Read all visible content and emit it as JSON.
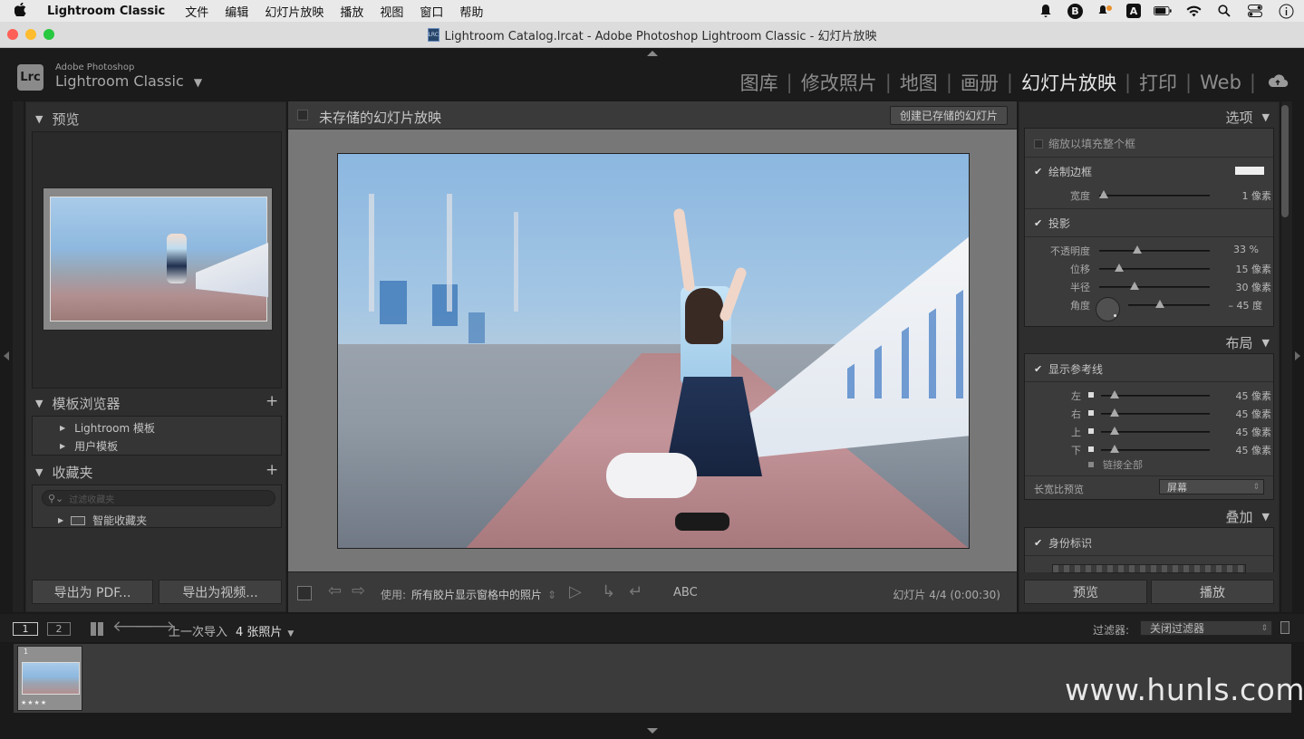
{
  "menubar": {
    "apple": "",
    "app": "Lightroom Classic",
    "items": [
      "文件",
      "编辑",
      "幻灯片放映",
      "播放",
      "视图",
      "窗口",
      "帮助"
    ],
    "status_icons": [
      "bell-icon",
      "b-badge-icon",
      "notification-icon",
      "a-input-icon",
      "battery-icon",
      "wifi-icon",
      "search-icon",
      "control-center-icon",
      "info-icon"
    ]
  },
  "window": {
    "title": "Lightroom Catalog.lrcat - Adobe Photoshop Lightroom Classic - 幻灯片放映",
    "doc_icon_text": "LRC"
  },
  "identity": {
    "badge": "Lrc",
    "adobe": "Adobe Photoshop",
    "product": "Lightroom Classic",
    "dropdown": "▼"
  },
  "modules": [
    {
      "label": "图库",
      "active": false
    },
    {
      "label": "修改照片",
      "active": false
    },
    {
      "label": "地图",
      "active": false
    },
    {
      "label": "画册",
      "active": false
    },
    {
      "label": "幻灯片放映",
      "active": true
    },
    {
      "label": "打印",
      "active": false
    },
    {
      "label": "Web",
      "active": false
    }
  ],
  "separator": "|",
  "left_panel": {
    "preview_title": "预览",
    "template_browser_title": "模板浏览器",
    "template_items": [
      "Lightroom 模板",
      "用户模板"
    ],
    "collections_title": "收藏夹",
    "collections_search_placeholder": "过滤收藏夹",
    "collections_items": [
      "智能收藏夹"
    ],
    "plus": "+",
    "export_pdf": "导出为 PDF...",
    "export_video": "导出为视频..."
  },
  "center": {
    "slideshow_title": "未存储的幻灯片放映",
    "create_saved": "创建已存储的幻灯片",
    "toolbar": {
      "use_label": "使用:",
      "use_value": "所有胶片显示窗格中的照片",
      "abc": "ABC",
      "slide_counter": "幻灯片 4/4 (0:00:30)"
    }
  },
  "right_panel": {
    "options_title": "选项",
    "zoom_fill": "缩放以填充整个框",
    "zoom_fill_checked": false,
    "stroke_border": "绘制边框",
    "stroke_border_checked": true,
    "stroke_width_label": "宽度",
    "stroke_width_value": "1 像素",
    "stroke_width_fraction": 0.0,
    "shadow": "投影",
    "shadow_checked": true,
    "shadow_rows": [
      {
        "label": "不透明度",
        "value": "33 %",
        "fraction": 0.33
      },
      {
        "label": "位移",
        "value": "15 像素",
        "fraction": 0.15
      },
      {
        "label": "半径",
        "value": "30 像素",
        "fraction": 0.3
      }
    ],
    "angle_label": "角度",
    "angle_value": "– 45 度",
    "angle_fraction": 0.375,
    "layout_title": "布局",
    "show_guides": "显示参考线",
    "show_guides_checked": true,
    "guide_rows": [
      {
        "label": "左",
        "value": "45 像素",
        "fraction": 0.09
      },
      {
        "label": "右",
        "value": "45 像素",
        "fraction": 0.09
      },
      {
        "label": "上",
        "value": "45 像素",
        "fraction": 0.09
      },
      {
        "label": "下",
        "value": "45 像素",
        "fraction": 0.09
      }
    ],
    "link_all": "链接全部",
    "aspect_label": "长宽比预览",
    "aspect_value": "屏幕",
    "overlays_title": "叠加",
    "identity_plate": "身份标识",
    "identity_plate_checked": true,
    "preview_button": "预览",
    "play_button": "播放"
  },
  "filmbar": {
    "view1": "1",
    "view2": "2",
    "source": "上一次导入",
    "count": "4 张照片",
    "filter_label": "过滤器:",
    "filter_value": "关闭过滤器"
  },
  "filmstrip": {
    "thumb_index": "1",
    "thumb_stars": "★★★★"
  },
  "watermark": "www.hunls.com",
  "colors": {
    "sky": "#8db6dd",
    "accent_active": "#e6e6e6",
    "panel_bg": "#2e2e2e"
  }
}
